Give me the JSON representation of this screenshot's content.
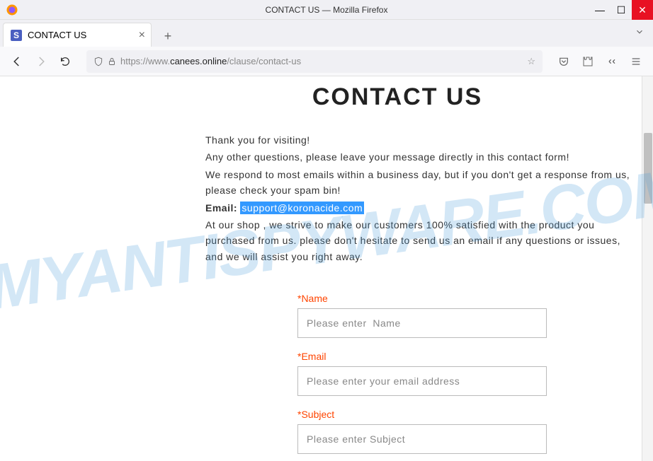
{
  "window": {
    "title": "CONTACT US — Mozilla Firefox"
  },
  "tab": {
    "title": "CONTACT US",
    "faviconLetter": "S"
  },
  "url": {
    "prefix": "https://www.",
    "domain": "canees.online",
    "path": "/clause/contact-us"
  },
  "page": {
    "heading": "CONTACT US",
    "intro": {
      "line1": "Thank you for visiting!",
      "line2": "Any other questions, please leave your message directly in this contact form!",
      "line3": "We respond to most emails within a business day, but if you don't get a response from us, please check your spam bin!",
      "emailLabel": "Email: ",
      "emailValue": "support@koronacide.com",
      "line5": "At our shop , we strive to make our customers 100% satisfied with the product you purchased from us. please don't hesitate to send us an email if any questions or issues, and we will assist you right away."
    },
    "form": {
      "name": {
        "label": "*Name",
        "placeholder": "Please enter  Name"
      },
      "email": {
        "label": "*Email",
        "placeholder": "Please enter your email address"
      },
      "subject": {
        "label": "*Subject",
        "placeholder": "Please enter Subject"
      }
    }
  },
  "watermark": "MYANTISPYWARE.COM"
}
